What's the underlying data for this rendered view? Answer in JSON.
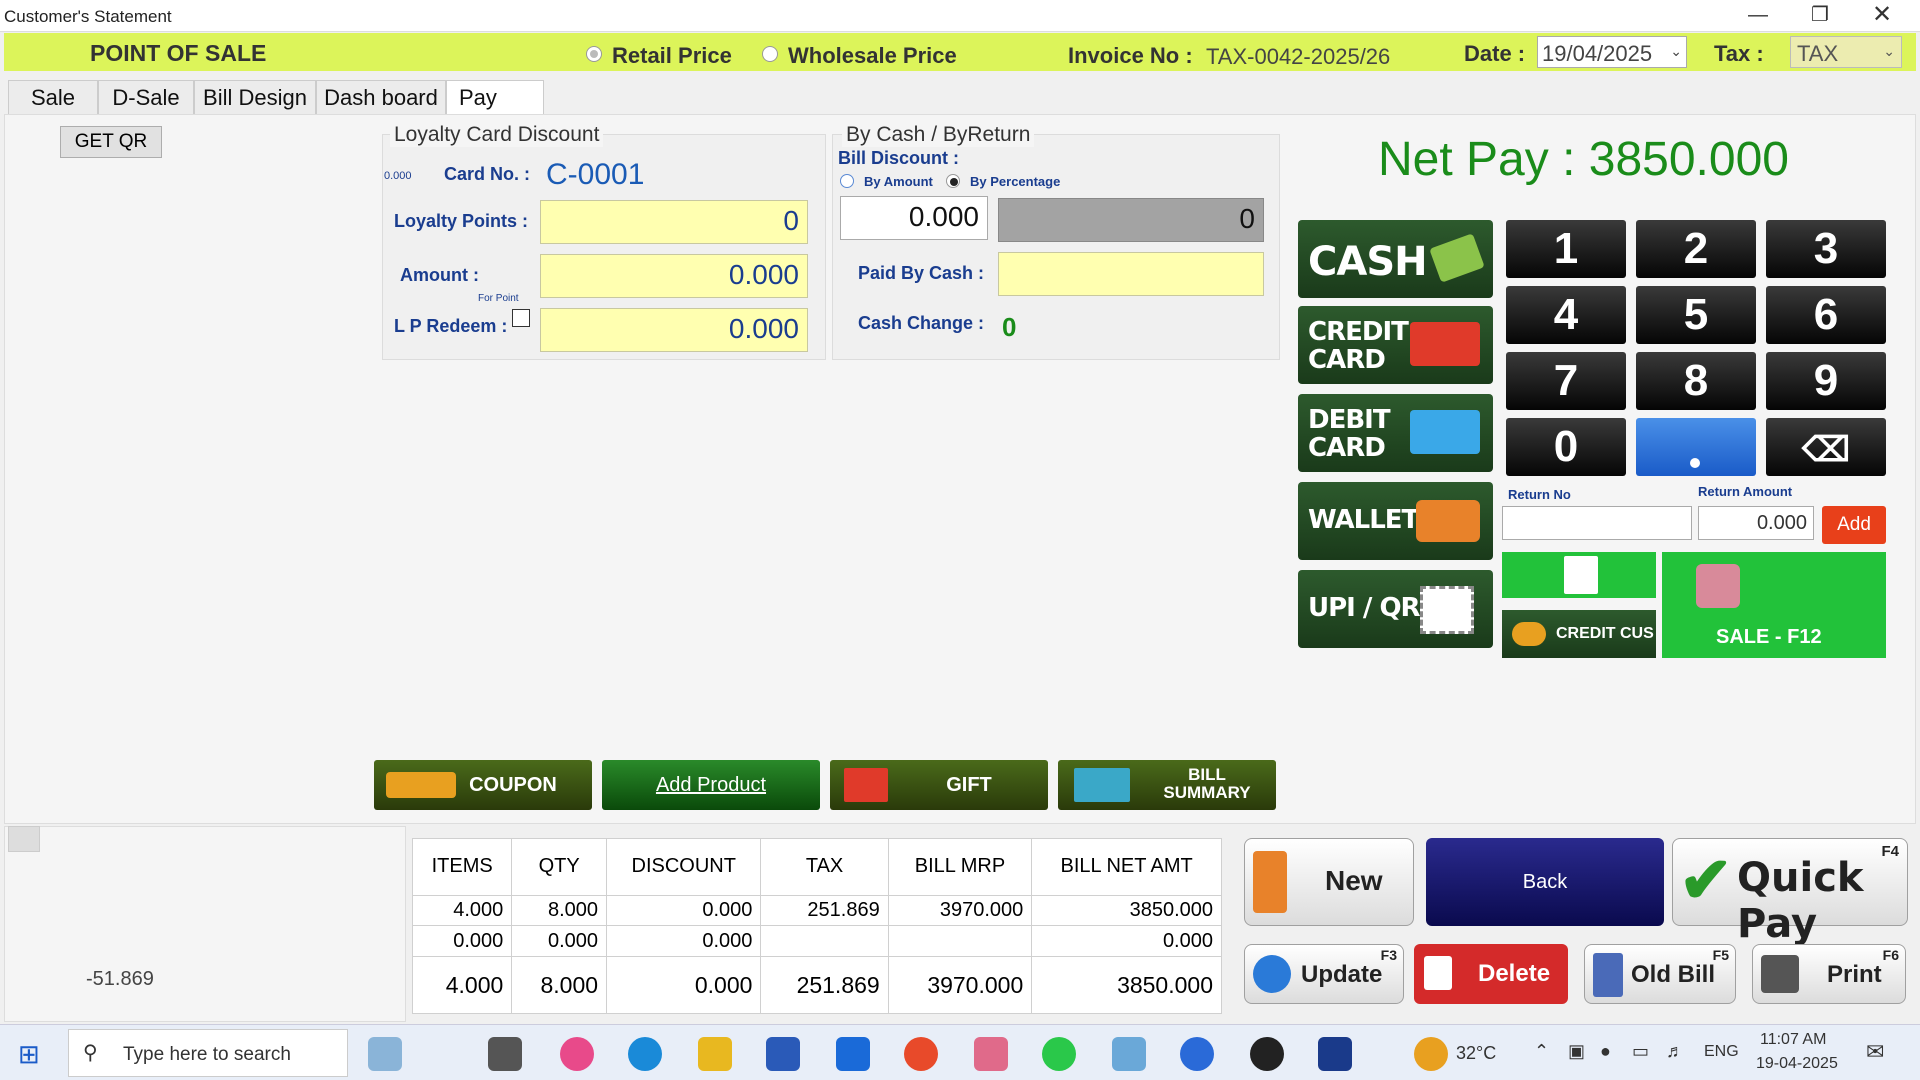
{
  "window": {
    "title": "Customer's Statement"
  },
  "header": {
    "title": "POINT OF SALE",
    "retail_price": "Retail Price",
    "wholesale_price": "Wholesale Price",
    "invoice_label": "Invoice No :",
    "invoice_no": "TAX-0042-2025/26",
    "date_label": "Date :",
    "date_value": "19/04/2025",
    "tax_label": "Tax :",
    "tax_value": "TAX"
  },
  "tabs": [
    "Sale",
    "D-Sale",
    "Bill Design",
    "Dash board",
    "Pay"
  ],
  "get_qr": "GET QR",
  "loyalty": {
    "title": "Loyalty Card Discount",
    "small_value": "0.000",
    "card_label": "Card No. :",
    "card_value": "C-0001",
    "points_label": "Loyalty Points :",
    "points_value": "0",
    "amount_label": "Amount  :",
    "amount_value": "0.000",
    "for_point": "For Point",
    "redeem_label": "L P Redeem :",
    "redeem_value": "0.000"
  },
  "cash": {
    "title": "By Cash / ByReturn",
    "bill_discount": "Bill Discount :",
    "by_amount": "By Amount",
    "by_percentage": "By Percentage",
    "discount_value": "0.000",
    "discount_result": "0",
    "paid_label": "Paid By Cash :",
    "change_label": "Cash Change :",
    "change_value": "0"
  },
  "netpay": {
    "label": "Net Pay : 3850.000"
  },
  "paymethods": {
    "cash": "CASH",
    "credit1": "CREDIT",
    "credit2": "CARD",
    "debit1": "DEBIT",
    "debit2": "CARD",
    "wallet": "WALLET",
    "upi": "UPI / QR"
  },
  "keypad": [
    "1",
    "2",
    "3",
    "4",
    "5",
    "6",
    "7",
    "8",
    "9",
    "0"
  ],
  "return": {
    "no_label": "Return No",
    "amount_label": "Return Amount",
    "amount_value": "0.000",
    "add": "Add",
    "credit_cus": "CREDIT CUS",
    "sale": "SALE - F12"
  },
  "actions": {
    "coupon": "COUPON",
    "add_product": "Add Product",
    "gift": "GIFT",
    "bill1": "BILL",
    "bill2": "SUMMARY"
  },
  "side_value": "-51.869",
  "summary": {
    "headers": [
      "ITEMS",
      "QTY",
      "DISCOUNT",
      "TAX",
      "BILL MRP",
      "BILL NET AMT"
    ],
    "rows": [
      [
        "4.000",
        "8.000",
        "0.000",
        "251.869",
        "3970.000",
        "3850.000"
      ],
      [
        "0.000",
        "0.000",
        "0.000",
        "",
        "",
        "0.000"
      ]
    ],
    "totals": [
      "4.000",
      "8.000",
      "0.000",
      "251.869",
      "3970.000",
      "3850.000"
    ]
  },
  "bigbuttons": {
    "new": "New",
    "back": "Back",
    "quick_pay": "Quick Pay",
    "f4": "F4",
    "update": "Update",
    "f3": "F3",
    "delete": "Delete",
    "old_bill": "Old Bill",
    "f5": "F5",
    "print": "Print",
    "f6": "F6"
  },
  "taskbar": {
    "search": "Type here to search",
    "temp": "32°C",
    "lang": "ENG",
    "time": "11:07 AM",
    "date": "19-04-2025"
  },
  "colors": {
    "header": "#dcf45a",
    "netpay": "#1a8c1a",
    "sale": "#22c23a",
    "delete": "#d42a2a",
    "back": "#1a1a6e"
  }
}
